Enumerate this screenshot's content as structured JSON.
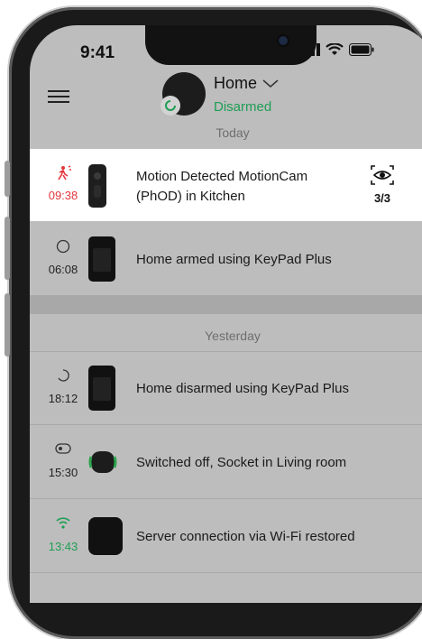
{
  "status_bar": {
    "time": "9:41"
  },
  "header": {
    "hub_name": "Home",
    "hub_state": "Disarmed",
    "chevron": "chevron-down-icon"
  },
  "colors": {
    "armed_alert": "#e2363b",
    "disarmed_green": "#1e9e54",
    "list_background": "#bdbdbd"
  },
  "sections": {
    "today": "Today",
    "yesterday": "Yesterday"
  },
  "events": [
    {
      "icon": "motion-alert-icon",
      "time": "09:38",
      "text_line1": "Motion Detected MotionCam",
      "text_line2": "(PhOD) in Kitchen",
      "views": "3/3",
      "device": "motioncam"
    },
    {
      "icon": "armed-circle-icon",
      "time": "06:08",
      "text_line1": "Home armed using KeyPad Plus",
      "device": "keypad"
    },
    {
      "icon": "disarmed-arc-icon",
      "time": "18:12",
      "text_line1": "Home disarmed using KeyPad Plus",
      "device": "keypad"
    },
    {
      "icon": "socket-off-icon",
      "time": "15:30",
      "text_line1": "Switched off, Socket in Living room",
      "device": "socket"
    },
    {
      "icon": "wifi-icon",
      "time": "13:43",
      "text_line1": "Server connection via Wi-Fi restored",
      "device": "hub"
    }
  ]
}
